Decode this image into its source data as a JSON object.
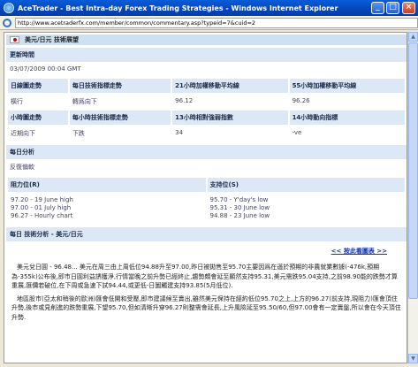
{
  "window": {
    "title": "AceTrader - Best Intra-day Forex Trading Strategies - Windows Internet Explorer",
    "url": "http://www.acetraderfx.com/member/common/commentary.asp?typeid=7&cuid=2"
  },
  "page": {
    "heading": "美元/日元 技術展望",
    "update_label": "更新時間",
    "update_time": "03/07/2009 00:04 GMT",
    "indicators": {
      "row1_headers": [
        "日線圖走勢",
        "每日技術指標走勢",
        "21小時加權移動平均線",
        "55小時加權移動平均線"
      ],
      "row1_values": [
        "橫行",
        "轉爲向下",
        "96.12",
        "96.26"
      ],
      "row2_headers": [
        "小時圖走勢",
        "每小時技術指標走勢",
        "13小時相對強弱指數",
        "14小時動向指標"
      ],
      "row2_values": [
        "近期向下",
        "下跌",
        "34",
        "-ve"
      ]
    },
    "daily_analysis_label": "每日分析",
    "daily_analysis_value": "反復偏軟",
    "resistance_label": "阻力位(R)",
    "support_label": "支持位(S)",
    "resistance": [
      "97.20 - 19 June high",
      "97.00 - 01 July high",
      "96.27 - Hourly chart"
    ],
    "support": [
      "95.70 - Y'day's low",
      "95.31 - 30 June low",
      "94.88 - 23 June low"
    ],
    "analysis_header": "每日 技術分析 - 美元/日元",
    "back_link": "<< 按此看圖表 >>",
    "paragraphs": [
      "美元兌日圓 - 96.48... 美元在周三由上周低位94.88升至97.00,昨日被拋售至95.70主要因爲在遜於預期的非農就業數據(-476k,預期為-355k)公布後,即市日圓利益誘獲淨,行情當晚之前升勢已經終止,趨勢頗會延至顯然支持95.31,美元需跌95.04支持,之前98.90能的跌勢才算重展,匯價若破位,在下周或急速下試94.44,或更低-日圖觸建支持93.85(5月低位).",
      "地區股市(亞太和稍後的歐洲)匯會低開和受壓,即市建議候至賣出,雖然美元保持在經約低位95.70之上,上方的96.27(前支持,現阻力)匯會頂住升勢,後市或見削進的跌勢重展,下望95.70,但如清晰升穿96.27則整需會延長,上升風險延至95.50/60,但97.00會有一定賣盤,所以會在今天頂住升勢."
    ]
  }
}
